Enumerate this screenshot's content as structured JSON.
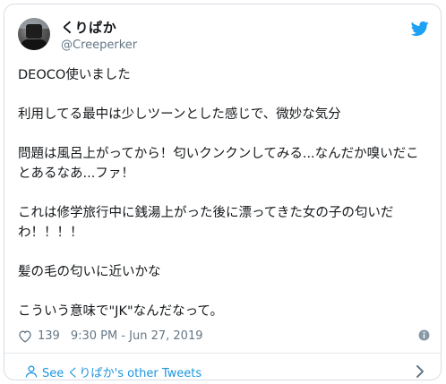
{
  "tweet": {
    "display_name": "くりぱか",
    "handle": "@Creeperker",
    "paragraphs": [
      "DEOCO使いました",
      "利用してる最中は少しツーンとした感じで、微妙な気分",
      "問題は風呂上がってから！匂いクンクンしてみる...なんだか嗅いだことあるなあ...ファ！",
      "これは修学旅行中に銭湯上がった後に漂ってきた女の子の匂いだわ！！！！",
      "髪の毛の匂いに近いかな",
      "こういう意味で\"JK\"なんだなって。"
    ],
    "likes": "139",
    "timestamp": "9:30 PM - Jun 27, 2019"
  },
  "footer": {
    "see_more_label": "See くりぱか's other Tweets"
  },
  "colors": {
    "twitter_blue": "#1da1f2",
    "link_blue": "#1b95e0",
    "secondary_text": "#657786"
  },
  "icons": [
    "twitter-bird-icon",
    "heart-icon",
    "info-icon",
    "person-icon",
    "chevron-right-icon"
  ]
}
